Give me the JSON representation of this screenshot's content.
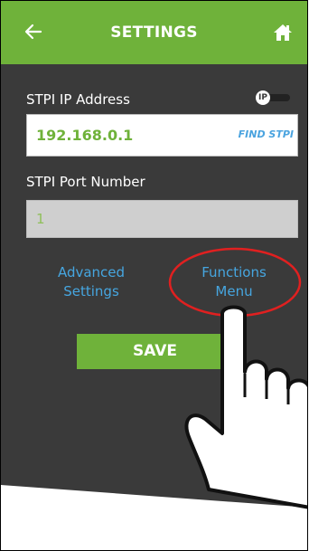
{
  "header": {
    "title": "SETTINGS",
    "back_icon": "back-arrow-icon",
    "home_icon": "home-icon"
  },
  "ip_section": {
    "label": "STPI IP Address",
    "toggle_label": "IP",
    "value": "192.168.0.1",
    "find_label": "FIND STPI"
  },
  "port_section": {
    "label": "STPI Port Number",
    "value": "1"
  },
  "links": {
    "advanced_line1": "Advanced",
    "advanced_line2": "Settings",
    "functions_line1": "Functions",
    "functions_line2": "Menu"
  },
  "save_label": "SAVE",
  "colors": {
    "accent": "#6fb23a",
    "background": "#3a3a3a",
    "link": "#46a6e0",
    "highlight_circle": "#e02020"
  }
}
